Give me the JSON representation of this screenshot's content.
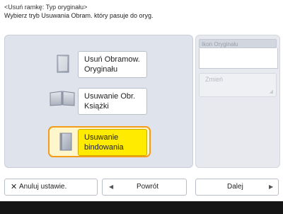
{
  "header": {
    "title": "<Usuń ramkę: Typ oryginału>",
    "instruction": "Wybierz tryb Usuwania Obram. który pasuje do oryg."
  },
  "options": [
    {
      "line1": "Usuń Obramow.",
      "line2": "Oryginału",
      "icon": "document-page-icon",
      "selected": false
    },
    {
      "line1": "Usuwanie Obr.",
      "line2": "Książki",
      "icon": "open-book-icon",
      "selected": false
    },
    {
      "line1": "Usuwanie",
      "line2": "bindowania",
      "icon": "bound-document-icon",
      "selected": true
    }
  ],
  "side_panel": {
    "header_label": "Ikon Oryginału",
    "change_label": "Zmień"
  },
  "footer_buttons": {
    "cancel_label": "Anuluj ustawie.",
    "back_label": "Powrót",
    "next_label": "Dalej"
  },
  "colors": {
    "panel_bg": "#dfe3eb",
    "selected_fill": "#ffeb00",
    "selected_ring": "#f39c1a",
    "footer_bar": "#151515"
  }
}
